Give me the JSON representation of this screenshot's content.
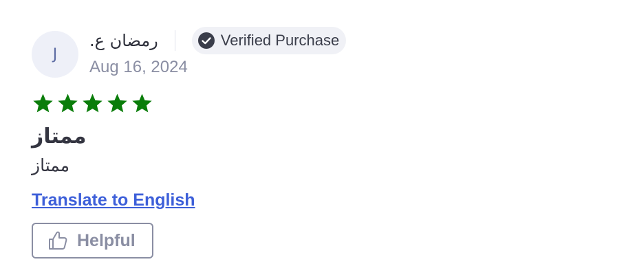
{
  "review": {
    "avatar_initial": "J",
    "reviewer_name": "رمضان ع.",
    "verified_label": "Verified Purchase",
    "date": "Aug 16, 2024",
    "rating": 5,
    "rating_max": 5,
    "title": "ممتاز",
    "body": "ممتاز",
    "translate_label": "Translate to English",
    "helpful_label": "Helpful"
  },
  "icons": {
    "verified": "check-circle-icon",
    "star": "star-icon",
    "helpful": "thumbs-up-icon"
  },
  "colors": {
    "star": "#0a7d0a",
    "link": "#3d5fd9",
    "verified_check": "#3a3d4a",
    "muted": "#8a8ea3"
  }
}
